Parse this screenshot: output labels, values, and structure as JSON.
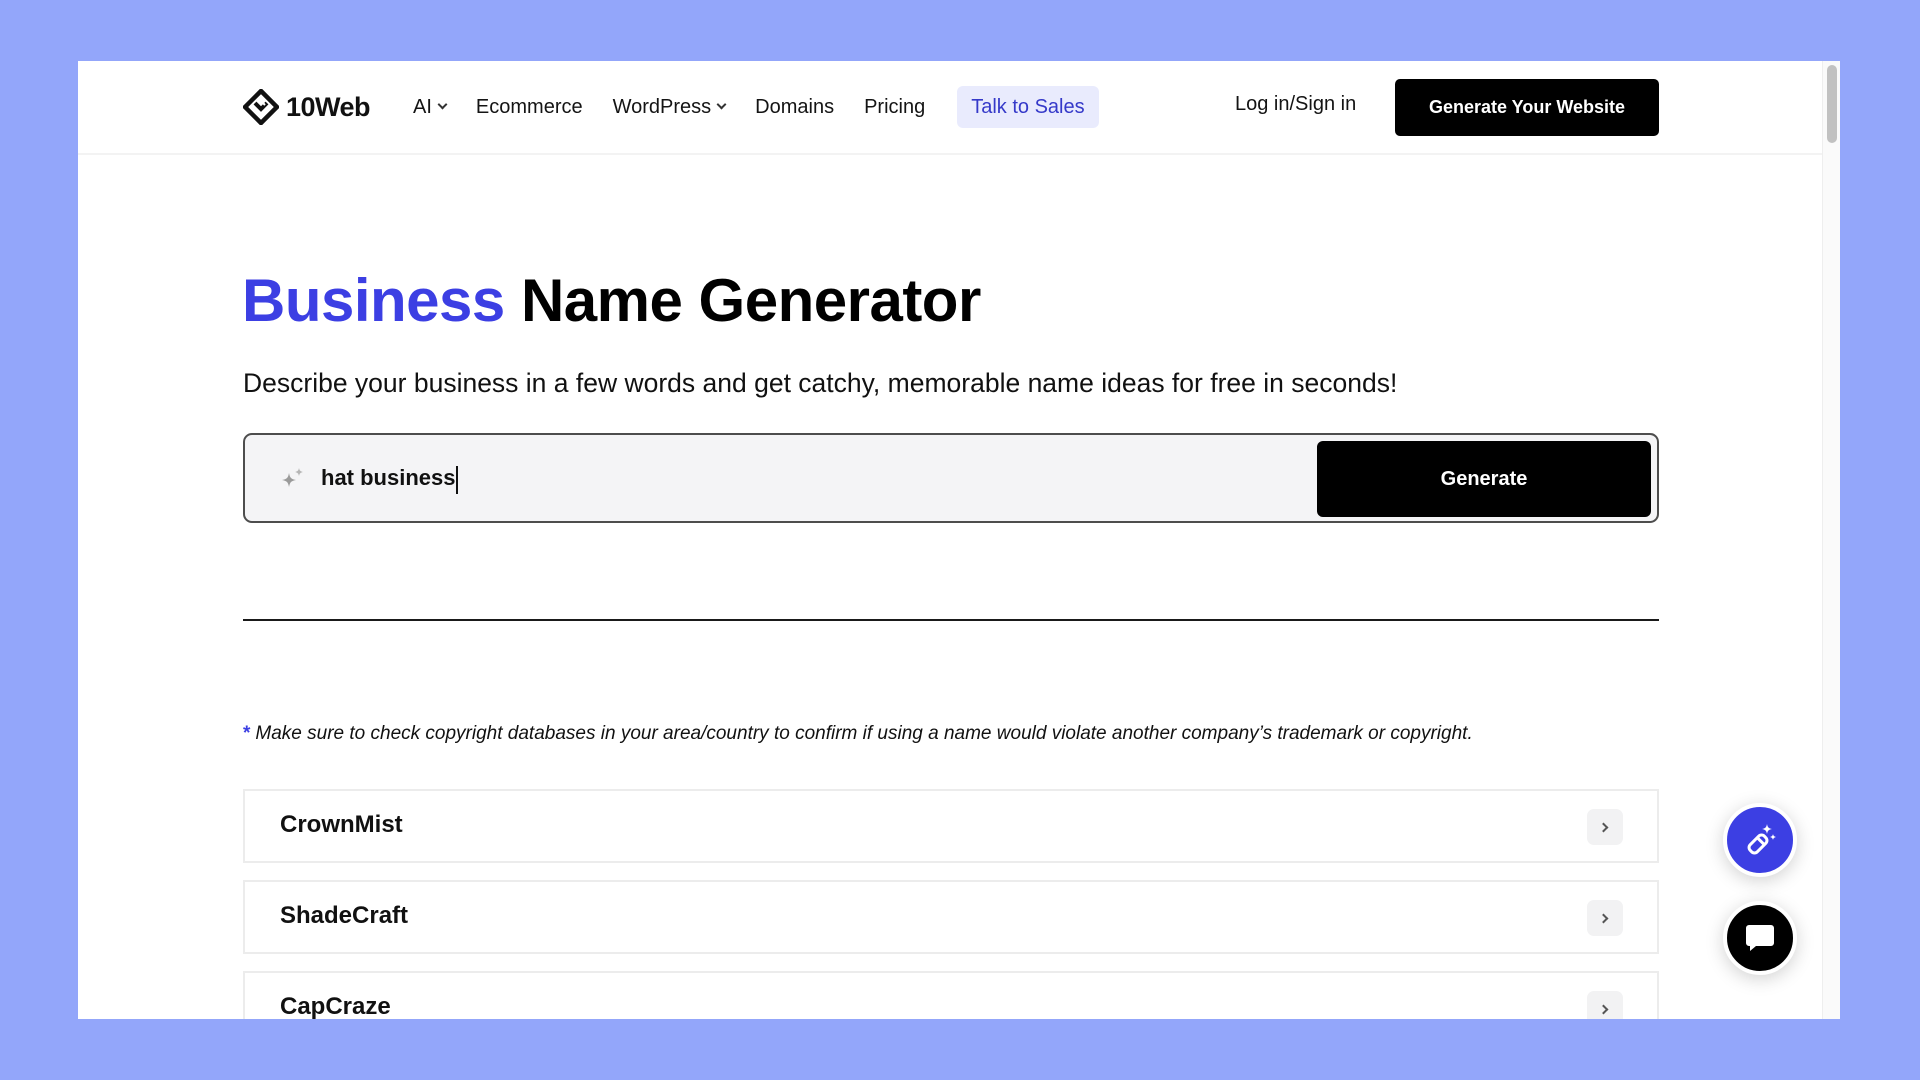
{
  "colors": {
    "accent": "#3c3fe3",
    "background": "#93a6fa",
    "sales_bg": "#e9ebfd",
    "button_dark": "#000000"
  },
  "header": {
    "logo_text": "10Web",
    "nav": [
      {
        "label": "AI",
        "has_dropdown": true
      },
      {
        "label": "Ecommerce",
        "has_dropdown": false
      },
      {
        "label": "WordPress",
        "has_dropdown": true
      },
      {
        "label": "Domains",
        "has_dropdown": false
      },
      {
        "label": "Pricing",
        "has_dropdown": false
      }
    ],
    "sales_label": "Talk to Sales",
    "login_label": "Log in/Sign in",
    "cta_label": "Generate Your Website"
  },
  "hero": {
    "title_accent": "Business",
    "title_rest": " Name Generator",
    "subtitle": "Describe your business in a few words and get catchy, memorable name ideas for free in seconds!"
  },
  "search": {
    "value": "hat business",
    "icon": "sparkle-icon",
    "button_label": "Generate"
  },
  "disclaimer": {
    "star": "*",
    "text": "Make sure to check copyright databases in your area/country to confirm if using a name would violate another company’s trademark or copyright."
  },
  "results": [
    {
      "name": "CrownMist"
    },
    {
      "name": "ShadeCraft"
    },
    {
      "name": "CapCraze"
    }
  ],
  "floating": {
    "ai_icon": "magic-pencil-icon",
    "chat_icon": "chat-bubble-icon"
  }
}
